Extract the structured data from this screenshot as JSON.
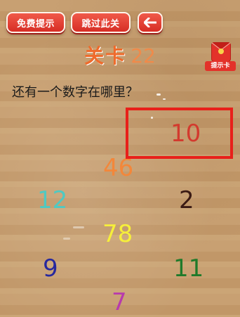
{
  "toolbar": {
    "hint_label": "免费提示",
    "skip_label": "跳过此关",
    "back_icon": "left-arrow-icon"
  },
  "level": {
    "label": "关卡",
    "number": "22"
  },
  "hint_card": {
    "icon": "red-envelope-icon",
    "label": "提示卡"
  },
  "question": "还有一个数字在哪里？",
  "numbers": [
    {
      "value": "10",
      "color": "#d33a2e"
    },
    {
      "value": "46",
      "color": "#f3873a"
    },
    {
      "value": "12",
      "color": "#4fc9c2"
    },
    {
      "value": "2",
      "color": "#3a1a14"
    },
    {
      "value": "78",
      "color": "#f6ef3a"
    },
    {
      "value": "9",
      "color": "#27289e"
    },
    {
      "value": "11",
      "color": "#1f7a2a"
    },
    {
      "value": "7",
      "color": "#b83aad"
    }
  ],
  "colors": {
    "button_red": "#e3322a",
    "highlight_red": "#e8201a",
    "level_orange": "#ef6b2c",
    "background_wood": "#c49a6c"
  }
}
